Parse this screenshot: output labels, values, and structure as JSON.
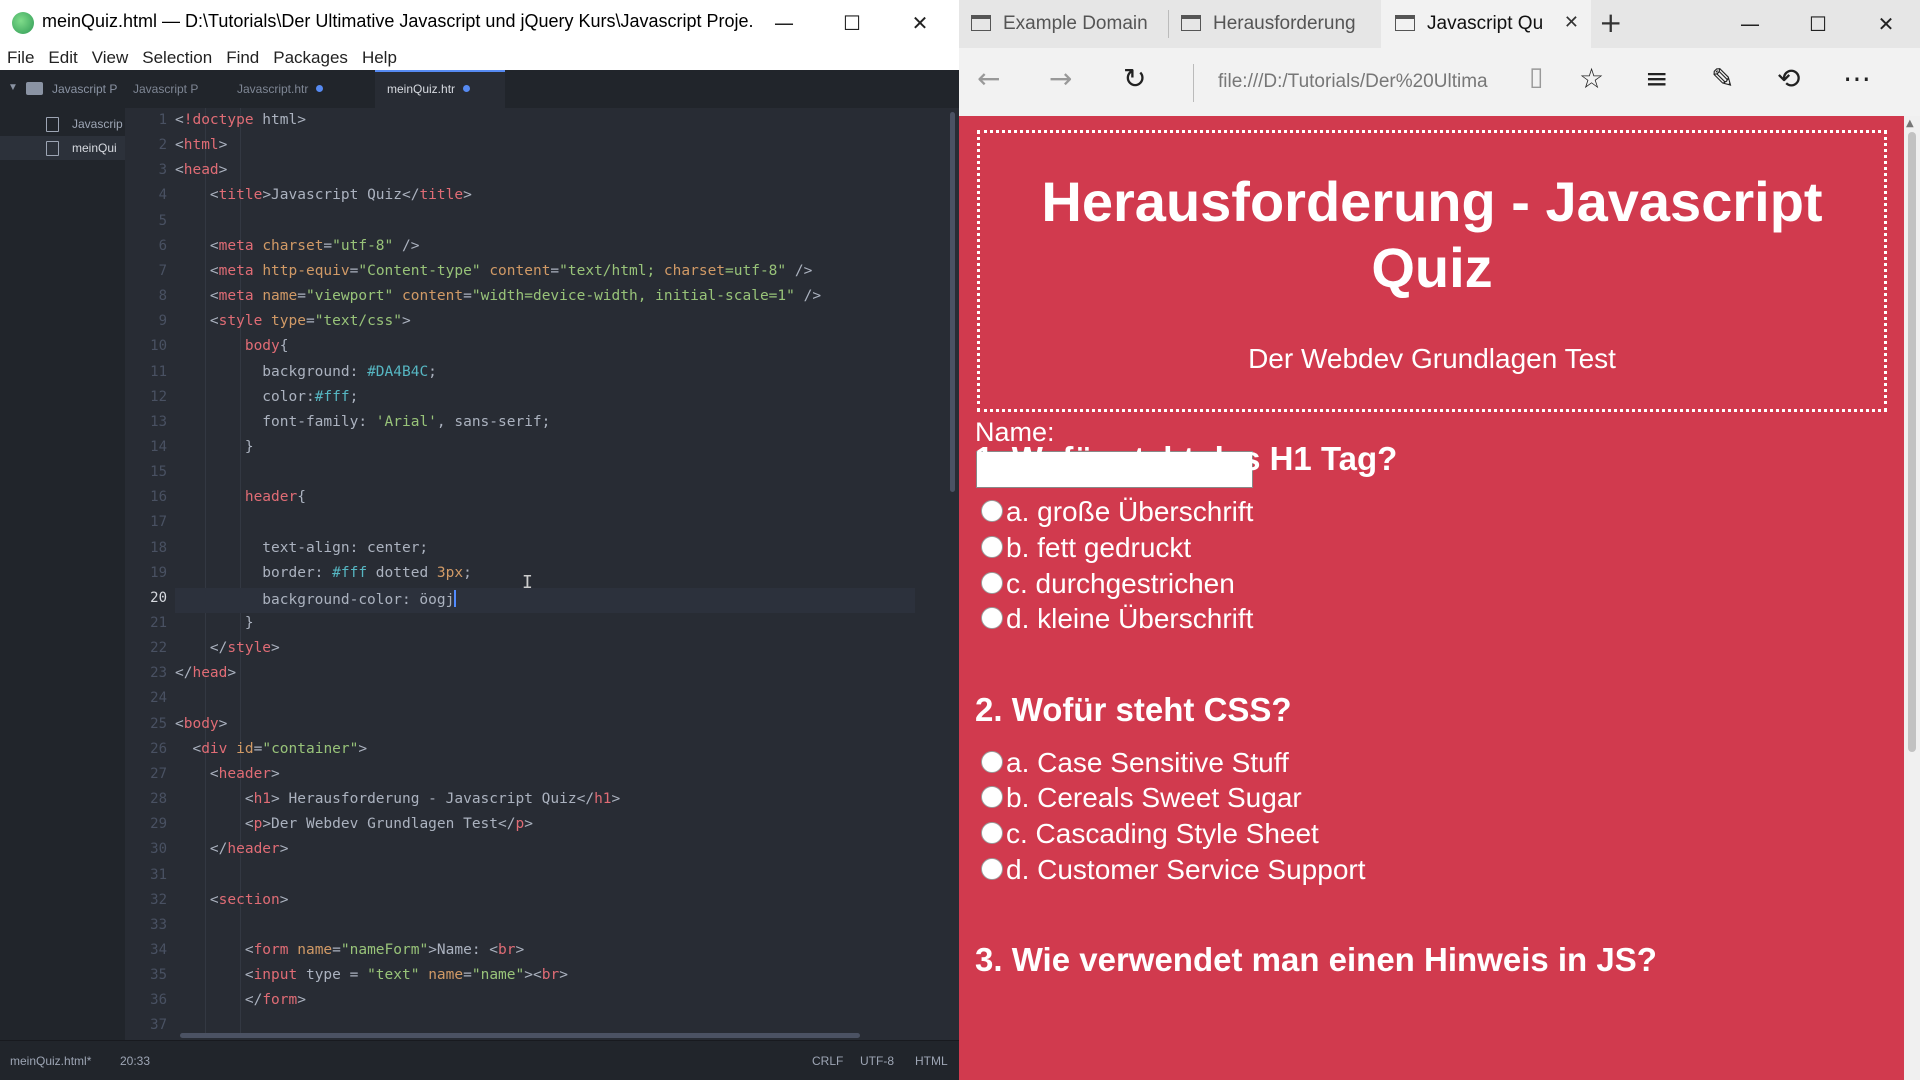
{
  "editor": {
    "window_title": "meinQuiz.html — D:\\Tutorials\\Der Ultimative Javascript und jQuery Kurs\\Javascript Proje...",
    "window_controls": {
      "minimize": "—",
      "maximize": "☐",
      "close": "✕"
    },
    "menu": [
      "File",
      "Edit",
      "View",
      "Selection",
      "Find",
      "Packages",
      "Help"
    ],
    "tree": {
      "project": "Javascript P",
      "files": [
        {
          "label": "Javascrip",
          "selected": false
        },
        {
          "label": "meinQui",
          "selected": true
        }
      ]
    },
    "tabs": [
      {
        "label": "Javascript P",
        "active": false,
        "modified": false
      },
      {
        "label": "Javascript.htr",
        "active": false,
        "modified": true
      },
      {
        "label": "meinQuiz.htr",
        "active": true,
        "modified": true
      }
    ],
    "line_numbers": [
      "1",
      "2",
      "3",
      "4",
      "5",
      "6",
      "7",
      "8",
      "9",
      "10",
      "11",
      "12",
      "13",
      "14",
      "15",
      "16",
      "17",
      "18",
      "19",
      "20",
      "21",
      "22",
      "23",
      "24",
      "25",
      "26",
      "27",
      "28",
      "29",
      "30",
      "31",
      "32",
      "33",
      "34",
      "35",
      "36",
      "37"
    ],
    "current_line": "20",
    "code_lines": [
      "<!doctype html>",
      "<html>",
      "<head>",
      "    <title>Javascript Quiz</title>",
      "",
      "    <meta charset=\"utf-8\" />",
      "    <meta http-equiv=\"Content-type\" content=\"text/html; charset=utf-8\" />",
      "    <meta name=\"viewport\" content=\"width=device-width, initial-scale=1\" />",
      "    <style type=\"text/css\">",
      "        body{",
      "          background: #DA4B4C;",
      "          color:#fff;",
      "          font-family: 'Arial', sans-serif;",
      "        }",
      "",
      "        header{",
      "",
      "          text-align: center;",
      "          border: #fff dotted 3px;",
      "          background-color: öogj",
      "        }",
      "    </style>",
      "</head>",
      "",
      "<body>",
      "  <div id=\"container\">",
      "    <header>",
      "        <h1> Herausforderung - Javascript Quiz</h1>",
      "        <p>Der Webdev Grundlagen Test</p>",
      "    </header>",
      "",
      "    <section>",
      "",
      "        <form name=\"nameForm\">Name: <br>",
      "        <input type = \"text\" name=\"name\"><br>",
      "        </form>",
      ""
    ],
    "status": {
      "file": "meinQuiz.html*",
      "cursor": "20:33",
      "line_ending": "CRLF",
      "encoding": "UTF-8",
      "grammar": "HTML"
    }
  },
  "browser": {
    "tabs": [
      {
        "label": "Example Domain",
        "active": false
      },
      {
        "label": "Herausforderung",
        "active": false
      },
      {
        "label": "Javascript Qu",
        "active": true
      }
    ],
    "new_tab": "+",
    "window_controls": {
      "minimize": "—",
      "maximize": "☐",
      "close": "✕"
    },
    "address": "file:///D:/Tutorials/Der%20Ultima",
    "nav_icons": [
      "back-icon",
      "forward-icon",
      "refresh-icon",
      "reading-view-icon",
      "favorite-star-icon",
      "hub-icon",
      "web-note-icon",
      "share-icon",
      "more-icon"
    ],
    "page": {
      "background": "#d13a4e",
      "header_title": "Herausforderung - Javascript Quiz",
      "header_subtitle": "Der Webdev Grundlagen Test",
      "name_label": "Name:",
      "name_value": "",
      "questions": [
        {
          "title": "1. Wofür steht das H1 Tag?",
          "options": [
            "a. große Überschrift",
            "b. fett gedruckt",
            "c. durchgestrichen",
            "d. kleine Überschrift"
          ]
        },
        {
          "title": "2. Wofür steht CSS?",
          "options": [
            "a. Case Sensitive Stuff",
            "b. Cereals Sweet Sugar",
            "c. Cascading Style Sheet",
            "d. Customer Service Support"
          ]
        },
        {
          "title": "3. Wie verwendet man einen Hinweis in JS?",
          "options": []
        }
      ]
    }
  }
}
